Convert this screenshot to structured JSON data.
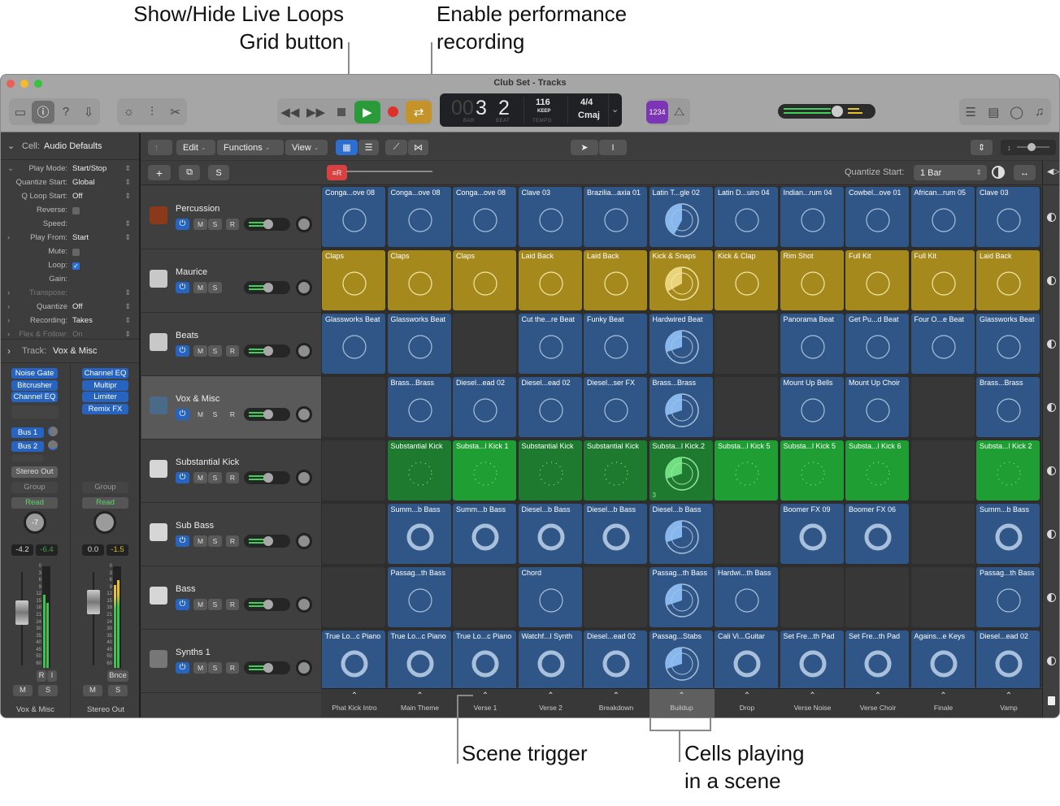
{
  "callouts": {
    "grid_button_line1": "Show/Hide Live Loops",
    "grid_button_line2": "Grid button",
    "perf_rec_line1": "Enable performance",
    "perf_rec_line2": "recording",
    "scene_trigger": "Scene trigger",
    "cells_playing_line1": "Cells playing",
    "cells_playing_line2": "in a scene"
  },
  "window": {
    "title": "Club Set - Tracks"
  },
  "transport": {
    "bar_prefix": "00",
    "bar": "3",
    "beat": "2",
    "bar_label": "BAR",
    "beat_label": "BEAT",
    "tempo": "116",
    "tempo_mode": "KEEP",
    "tempo_label": "TEMPO",
    "signature": "4/4",
    "key": "Cmaj",
    "count_in": "1234"
  },
  "colors": {
    "play": "#2b9a3a",
    "record": "#e0302a",
    "cycle": "#c4942a",
    "count_in": "#7b35b5",
    "cell_blue": "#2f5686",
    "cell_yellow": "#a5891d",
    "cell_green": "#1f9e33",
    "cell_green_dark": "#1e7a2f",
    "plugin_blue": "#2664c0",
    "perf_record": "#d94040",
    "grid_button_active": "#2c6fd0"
  },
  "master_volume": 0.78,
  "toolbar": {
    "edit": "Edit",
    "functions": "Functions",
    "view": "View",
    "add": "+",
    "solo": "S",
    "quantize_start_label": "Quantize Start:",
    "quantize_start_value": "1 Bar"
  },
  "inspector": {
    "cell_header": "Cell:",
    "cell_name": "Audio Defaults",
    "rows": [
      {
        "key": "Play Mode:",
        "value": "Start/Stop"
      },
      {
        "key": "Quantize Start:",
        "value": "Global"
      },
      {
        "key": "Q Loop Start:",
        "value": "Off"
      },
      {
        "key": "Reverse:",
        "value": ""
      },
      {
        "key": "Speed:",
        "value": ""
      },
      {
        "key": "Play From:",
        "value": "Start"
      },
      {
        "key": "Mute:",
        "value": ""
      },
      {
        "key": "Loop:",
        "value": "✓"
      },
      {
        "key": "Gain:",
        "value": ""
      },
      {
        "key": "Transpose:",
        "value": ""
      },
      {
        "key": "Quantize",
        "value": "Off"
      },
      {
        "key": "Recording:",
        "value": "Takes"
      },
      {
        "key": "Flex & Follow:",
        "value": "On"
      }
    ],
    "track_header": "Track:",
    "track_name": "Vox & Misc",
    "strip1": {
      "plugins": [
        "Noise Gate",
        "Bitcrusher",
        "Channel EQ"
      ],
      "sends": [
        "Bus 1",
        "Bus 2"
      ],
      "output": "Stereo Out",
      "group": "Group",
      "automation": "Read",
      "pan": "-7",
      "volume": "-4.2",
      "peak": "-6.4",
      "ri": [
        "R",
        "I"
      ],
      "mute": "M",
      "solo": "S",
      "name": "Vox & Misc"
    },
    "strip2": {
      "plugins": [
        "Channel EQ",
        "Multipr",
        "Limiter",
        "Remix FX"
      ],
      "group": "Group",
      "automation": "Read",
      "volume": "0.0",
      "peak": "-1.5",
      "bounce": "Bnce",
      "mute": "M",
      "solo": "S",
      "name": "Stereo Out"
    },
    "meter_scale": [
      "0",
      "3",
      "6",
      "9",
      "12",
      "15",
      "18",
      "21",
      "24",
      "30",
      "35",
      "40",
      "45",
      "50",
      "60"
    ]
  },
  "track_buttons": {
    "mute": "M",
    "solo": "S",
    "record": "R"
  },
  "tracks": [
    {
      "name": "Percussion",
      "icon": "congas-icon",
      "has_record": true
    },
    {
      "name": "Maurice",
      "icon": "drum-machine-icon",
      "has_record": false
    },
    {
      "name": "Beats",
      "icon": "drum-machine-icon",
      "has_record": true
    },
    {
      "name": "Vox & Misc",
      "icon": "turntable-icon",
      "has_record": true
    },
    {
      "name": "Substantial Kick",
      "icon": "synth-icon",
      "has_record": true
    },
    {
      "name": "Sub Bass",
      "icon": "synth-icon",
      "has_record": true
    },
    {
      "name": "Bass",
      "icon": "synth-icon",
      "has_record": true
    },
    {
      "name": "Synths 1",
      "icon": "keyboard-stand-icon",
      "has_record": true
    }
  ],
  "grid": [
    [
      "Conga...ove 08",
      "Conga...ove 08",
      "Conga...ove 08",
      "Clave 03",
      "Brazilia...axia 01",
      "Latin T...gle 02",
      "Latin D...uiro 04",
      "Indian...rum 04",
      "Cowbel...ove 01",
      "African...rum 05",
      "Clave 03"
    ],
    [
      "Claps",
      "Claps",
      "Claps",
      "Laid Back",
      "Laid Back",
      "Kick & Snaps",
      "Kick & Clap",
      "Rim Shot",
      "Full Kit",
      "Full Kit",
      "Laid Back"
    ],
    [
      "Glassworks Beat",
      "Glassworks Beat",
      "",
      "Cut the...re Beat",
      "Funky Beat",
      "Hardwired Beat",
      "",
      "Panorama Beat",
      "Get Pu...d Beat",
      "Four O...e Beat",
      "Glassworks Beat"
    ],
    [
      "",
      "Brass...Brass",
      "Diesel...ead 02",
      "Diesel...ead 02",
      "Diesel...ser FX",
      "Brass...Brass",
      "",
      "Mount Up Bells",
      "Mount Up Choir",
      "",
      "Brass...Brass"
    ],
    [
      "",
      "Substantial Kick",
      "Substa...l Kick 1",
      "Substantial Kick",
      "Substantial Kick",
      "Substa...l Kick.2",
      "Substa...l Kick 5",
      "Substa...l Kick 5",
      "Substa...l Kick 6",
      "",
      "Substa...l Kick 2"
    ],
    [
      "",
      "Summ...b Bass",
      "Summ...b Bass",
      "Diesel...b Bass",
      "Diesel...b Bass",
      "Diesel...b Bass",
      "",
      "Boomer FX 09",
      "Boomer FX 06",
      "",
      "Summ...b Bass"
    ],
    [
      "",
      "Passag...th Bass",
      "",
      "Chord",
      "",
      "Passag...th Bass",
      "Hardwi...th Bass",
      "",
      "",
      "",
      "Passag...th Bass"
    ],
    [
      "True Lo...c Piano",
      "True Lo...c Piano",
      "True Lo...c Piano",
      "Watchf...l Synth",
      "Diesel...ead 02",
      "Passag...Stabs",
      "Cali Vi...Guitar",
      "Set Fre...th Pad",
      "Set Fre...th Pad",
      "Agains...e Keys",
      "Diesel...ead 02"
    ]
  ],
  "grid_row_colors": [
    "blue",
    "yellow",
    "blue",
    "blue",
    "green",
    "blue",
    "blue",
    "blue"
  ],
  "playing_column": 5,
  "playing_progress": [
    0.42,
    0.33,
    0.3,
    0.3,
    0.3,
    0.3,
    0.3,
    0.3
  ],
  "take_count": "3",
  "scenes": [
    "Phat Kick Intro",
    "Main Theme",
    "Verse 1",
    "Verse 2",
    "Breakdown",
    "Buildup",
    "Drop",
    "Verse Noise",
    "Verse Choir",
    "Finale",
    "Vamp"
  ],
  "active_scene": 5
}
